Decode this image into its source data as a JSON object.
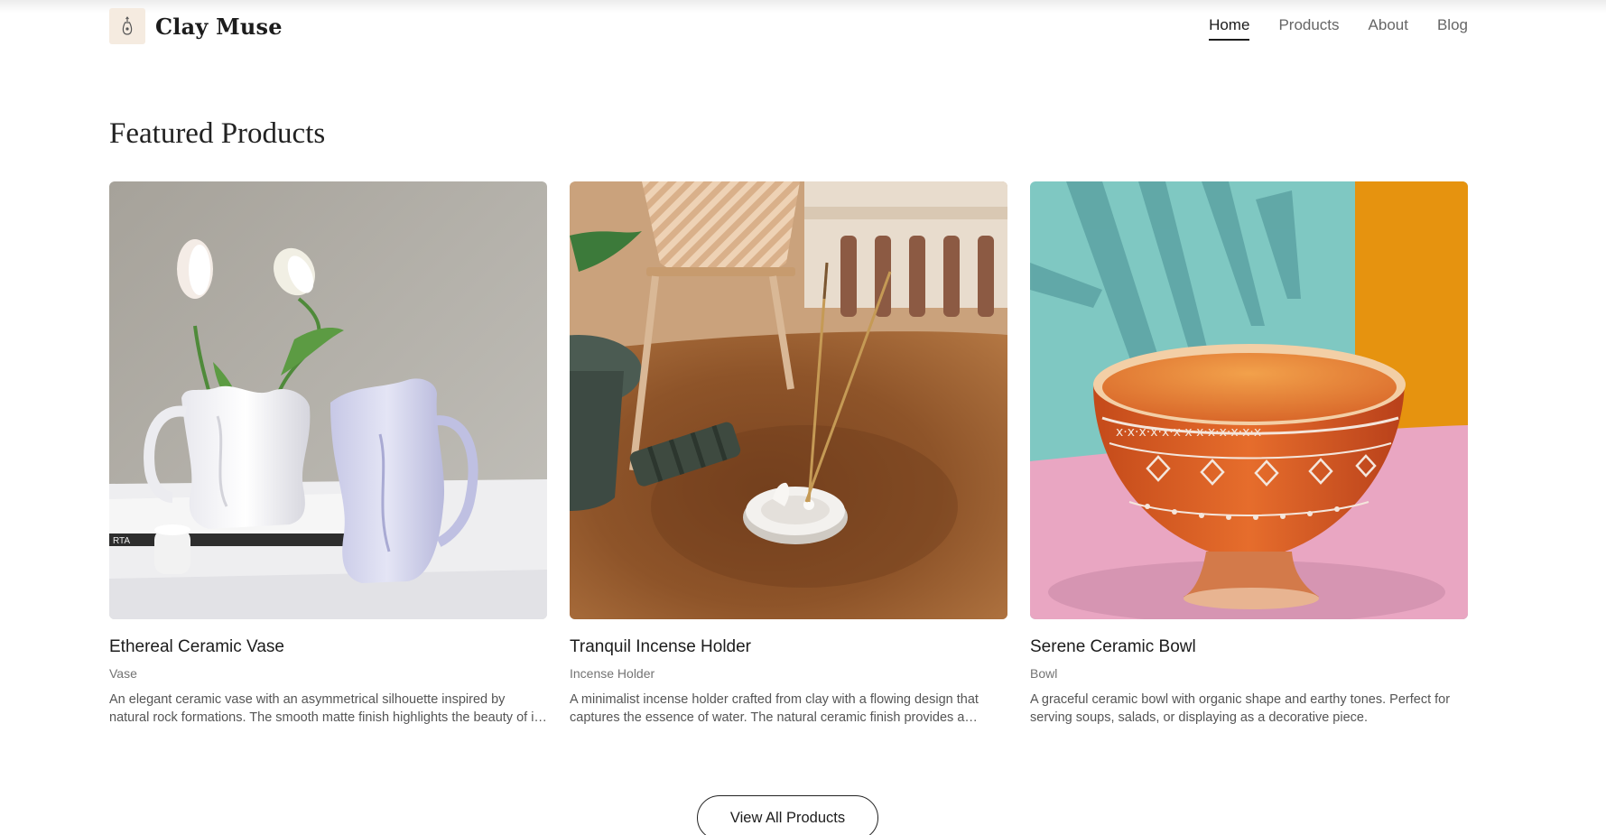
{
  "brand": {
    "name": "Clay Muse",
    "logo_icon": "vase-logo-icon"
  },
  "nav": {
    "items": [
      {
        "label": "Home",
        "active": true
      },
      {
        "label": "Products",
        "active": false
      },
      {
        "label": "About",
        "active": false
      },
      {
        "label": "Blog",
        "active": false
      }
    ]
  },
  "featured": {
    "title": "Featured Products",
    "products": [
      {
        "name": "Ethereal Ceramic Vase",
        "category": "Vase",
        "description": "An elegant ceramic vase with an asymmetrical silhouette inspired by natural rock formations. The smooth matte finish highlights the beauty of its organic form."
      },
      {
        "name": "Tranquil Incense Holder",
        "category": "Incense Holder",
        "description": "A minimalist incense holder crafted from clay with a flowing design that captures the essence of water. The natural ceramic finish provides a calming presence."
      },
      {
        "name": "Serene Ceramic Bowl",
        "category": "Bowl",
        "description": "A graceful ceramic bowl with organic shape and earthy tones. Perfect for serving soups, salads, or displaying as a decorative piece."
      }
    ],
    "view_all_label": "View All Products"
  },
  "colors": {
    "accent": "#1c1c1c",
    "logo_bg": "#f5ebe0",
    "muted_text": "#737373"
  }
}
